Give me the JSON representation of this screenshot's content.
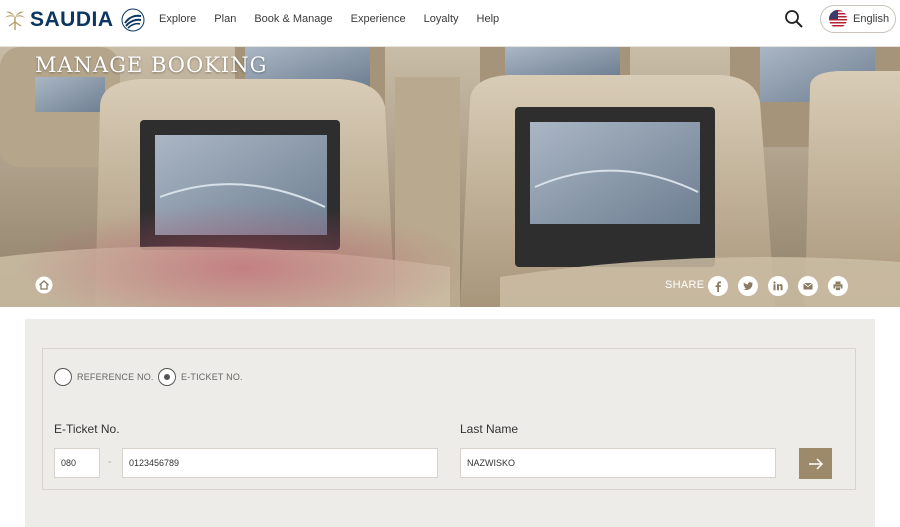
{
  "brand": {
    "name": "SAUDIA"
  },
  "nav": {
    "items": [
      {
        "label": "Explore"
      },
      {
        "label": "Plan"
      },
      {
        "label": "Book & Manage"
      },
      {
        "label": "Experience"
      },
      {
        "label": "Loyalty"
      },
      {
        "label": "Help"
      }
    ],
    "language": "English"
  },
  "hero": {
    "title": "MANAGE BOOKING",
    "share_label": "SHARE",
    "share_icons": [
      "facebook-icon",
      "twitter-icon",
      "linkedin-icon",
      "mail-icon",
      "print-icon"
    ]
  },
  "form": {
    "options": [
      {
        "label": "REFERENCE NO.",
        "selected": false
      },
      {
        "label": "E-TICKET NO.",
        "selected": true
      }
    ],
    "eticket_label": "E-Ticket No.",
    "prefix_value": "080",
    "separator": "-",
    "ticket_value": "0123456789",
    "lastname_label": "Last Name",
    "lastname_value": "NAZWISKO"
  },
  "colors": {
    "brand_navy": "#0c3661",
    "accent_gold": "#9c8a6a",
    "panel_bg": "#eeece8"
  }
}
